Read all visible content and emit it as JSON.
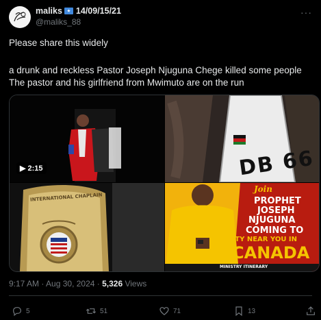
{
  "author": {
    "name": "maliks",
    "date": "14/09/15/21",
    "handle": "@maliks_88"
  },
  "tweet": {
    "line1": "Please share this widely",
    "line2": "a drunk and reckless Pastor Joseph Njuguna Chege killed some people",
    "line3": "The pastor and his girlfriend from Mwimuto are on the run"
  },
  "media": {
    "video_duration": "2:15",
    "plate_text": "DB 66",
    "badge_text": "INTERNATIONAL CHAPLAIN",
    "poster": {
      "join": "Join",
      "line1": "PROPHET",
      "line2": "JOSEPH",
      "line3": "NJUGUNA",
      "line4": "COMING TO",
      "line5": "A CITY NEAR YOU IN",
      "line6": "CANADA",
      "footer": "MINISTRY ITINERARY"
    }
  },
  "meta": {
    "time": "9:17 AM · Aug 30, 2024 · ",
    "views_count": "5,326",
    "views_label": "Views"
  },
  "actions": {
    "replies": "5",
    "reposts": "51",
    "likes": "71",
    "bookmarks": "13"
  },
  "colors": {
    "background": "#000000",
    "text": "#e7e9ea",
    "muted": "#71767b",
    "divider": "#2f3336",
    "poster_red": "#b81c10",
    "poster_yellow": "#f5c400"
  }
}
